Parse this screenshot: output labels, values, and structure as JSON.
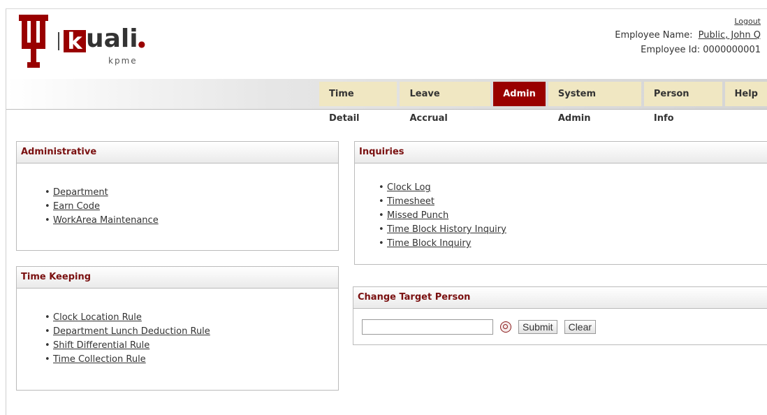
{
  "header": {
    "logo_text": "kuali",
    "logo_initial": "k",
    "logo_rest": "uali",
    "logo_subtext": "kpme",
    "logout": "Logout",
    "employee_name_label": "Employee Name:",
    "employee_name_value": "Public, John Q",
    "employee_id_label": "Employee Id:",
    "employee_id_value": "0000000001"
  },
  "nav": {
    "tabs": [
      {
        "label": "Time Detail",
        "active": false
      },
      {
        "label": "Leave Accrual",
        "active": false
      },
      {
        "label": "Admin",
        "active": true
      },
      {
        "label": "System Admin",
        "active": false
      },
      {
        "label": "Person Info",
        "active": false
      },
      {
        "label": "Help",
        "active": false
      }
    ]
  },
  "administrative": {
    "title": "Administrative",
    "items": [
      "Department",
      "Earn Code",
      "WorkArea Maintenance"
    ]
  },
  "time_keeping": {
    "title": "Time Keeping",
    "items": [
      "Clock Location Rule",
      "Department Lunch Deduction Rule",
      "Shift Differential Rule",
      "Time Collection Rule"
    ]
  },
  "inquiries": {
    "title": "Inquiries",
    "items": [
      "Clock Log",
      "Timesheet",
      "Missed Punch",
      "Time Block History Inquiry",
      "Time Block Inquiry"
    ]
  },
  "change_target": {
    "title": "Change Target Person",
    "input_value": "",
    "submit_label": "Submit",
    "clear_label": "Clear"
  },
  "colors": {
    "brand": "#990000",
    "tab_bg": "#f0e7c2",
    "panel_title": "#7a1010"
  }
}
